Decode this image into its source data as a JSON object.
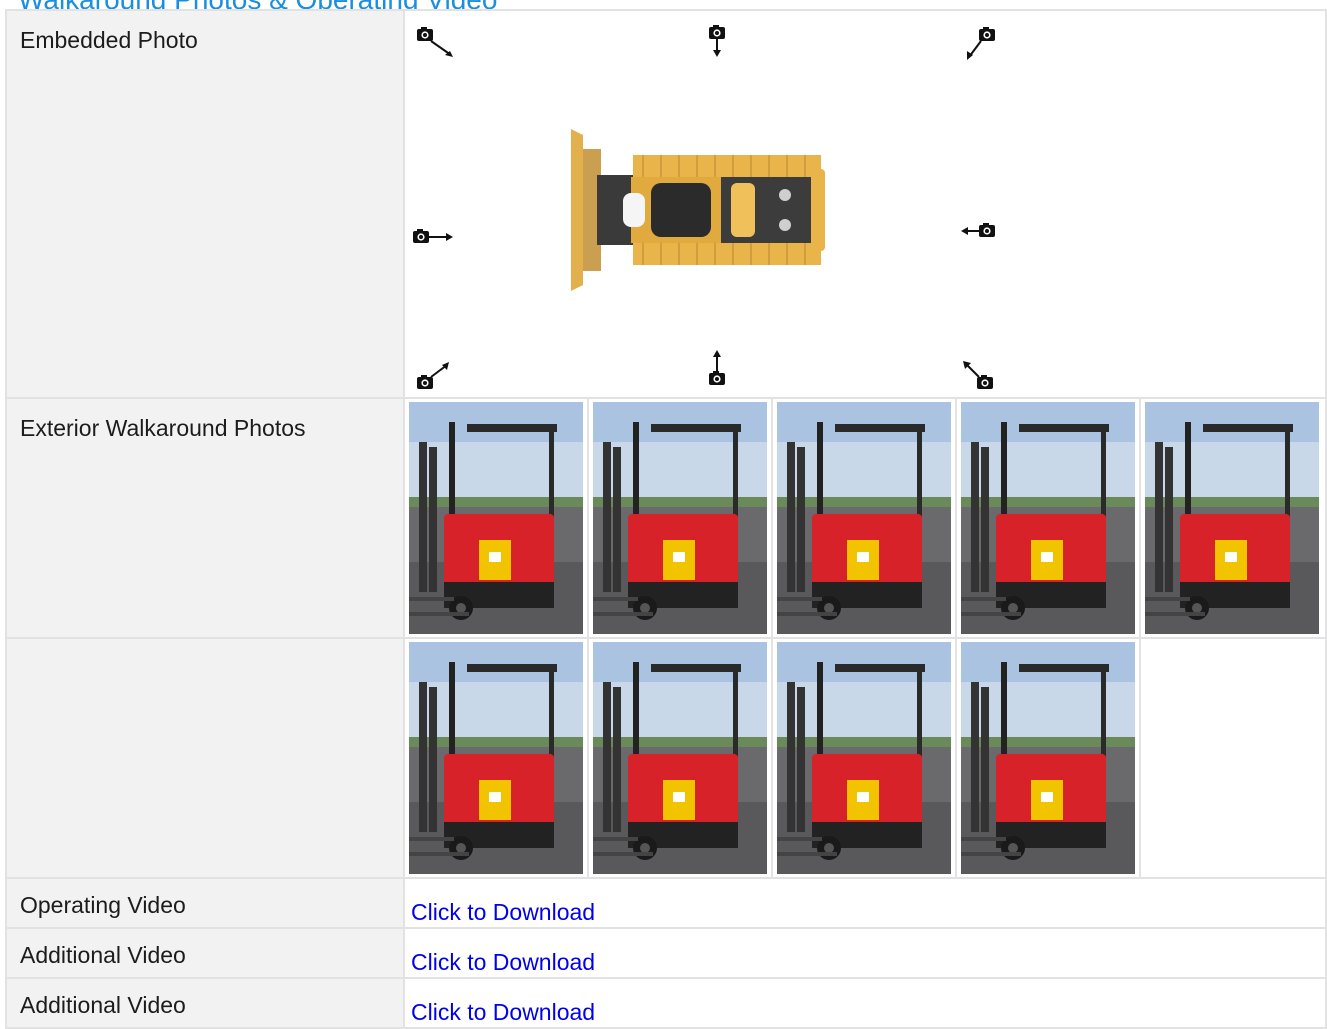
{
  "page": {
    "title": "Walkaround Photos & Operating Video"
  },
  "rows": {
    "embedded_photo": {
      "label": "Embedded Photo"
    },
    "exterior": {
      "label": "Exterior Walkaround Photos"
    },
    "operating_video": {
      "label": "Operating Video",
      "link": "Click to Download"
    },
    "additional_video_1": {
      "label": "Additional Video",
      "link": "Click to Download"
    },
    "additional_video_2": {
      "label": "Additional Video",
      "link": "Click to Download"
    }
  },
  "diagram": {
    "machine_icon": "bulldozer-top-view",
    "camera_icons": [
      "camera-front-left-icon",
      "camera-front-icon",
      "camera-front-right-icon",
      "camera-left-icon",
      "camera-right-icon",
      "camera-rear-left-icon",
      "camera-rear-icon",
      "camera-rear-right-icon"
    ]
  },
  "photos": {
    "row1": [
      "forklift-photo-1",
      "forklift-photo-2",
      "forklift-photo-3",
      "forklift-photo-4",
      "forklift-photo-5"
    ],
    "row2": [
      "forklift-photo-6",
      "forklift-photo-7",
      "forklift-photo-8",
      "forklift-photo-9"
    ]
  },
  "colors": {
    "title": "#1a8fe0",
    "link": "#0000ee",
    "label_bg": "#f2f2f2",
    "forklift_red": "#d8222a",
    "battery_yellow": "#f2c400",
    "dozer_yellow": "#e9b54a"
  }
}
